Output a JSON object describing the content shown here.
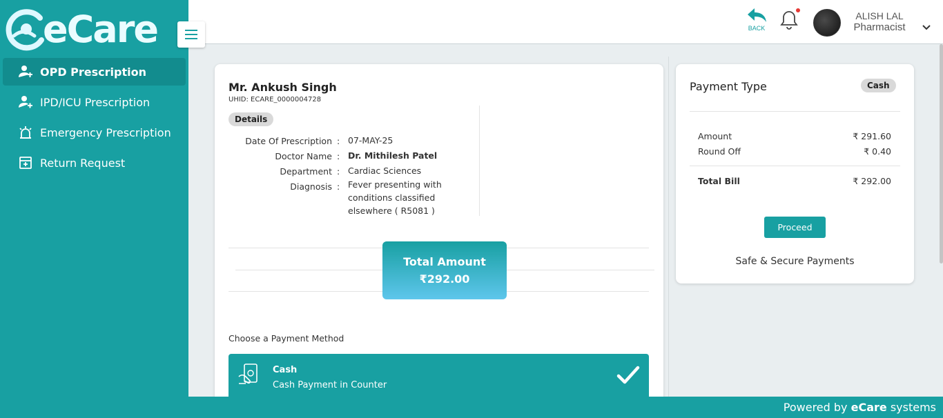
{
  "brand": {
    "logo_text": "eCare"
  },
  "sidebar": {
    "items": [
      {
        "label": "OPD Prescription",
        "icon": "user-prescription-icon",
        "active": true
      },
      {
        "label": "IPD/ICU Prescription",
        "icon": "user-add-icon",
        "active": false
      },
      {
        "label": "Emergency Prescription",
        "icon": "siren-icon",
        "active": false
      },
      {
        "label": "Return Request",
        "icon": "archive-box-icon",
        "active": false
      }
    ]
  },
  "header": {
    "back_label": "BACK",
    "user_name": "ALISH LAL",
    "user_role": "Pharmacist"
  },
  "patient": {
    "name": "Mr. Ankush Singh",
    "uhid": "UHID: ECARE_0000004728",
    "details_badge": "Details",
    "fields": [
      {
        "label": "Date Of Prescription",
        "value": "07-MAY-25"
      },
      {
        "label": "Doctor Name",
        "value": "Dr. Mithilesh Patel"
      },
      {
        "label": "Department",
        "value": "Cardiac Sciences"
      },
      {
        "label": "Diagnosis",
        "value": "Fever presenting with conditions classified elsewhere ( R5081 )"
      }
    ],
    "colon": ":"
  },
  "total": {
    "label": "Total Amount",
    "amount": "₹292.00"
  },
  "payment_methods": {
    "heading": "Choose a Payment Method",
    "selected": {
      "title": "Cash",
      "subtitle": "Cash Payment in Counter"
    }
  },
  "payment_summary": {
    "title": "Payment Type",
    "type_badge": "Cash",
    "amount_label": "Amount",
    "amount_value": "₹ 291.60",
    "roundoff_label": "Round Off",
    "roundoff_value": "₹ 0.40",
    "total_label": "Total Bill",
    "total_value": "₹ 292.00",
    "proceed_label": "Proceed",
    "secure_text": "Safe & Secure Payments"
  },
  "footer": {
    "prefix": "Powered by ",
    "brand": "eCare",
    "suffix": " systems"
  },
  "colors": {
    "primary": "#18a0a2",
    "active_nav": "#128c8e",
    "notification": "#e53935"
  }
}
